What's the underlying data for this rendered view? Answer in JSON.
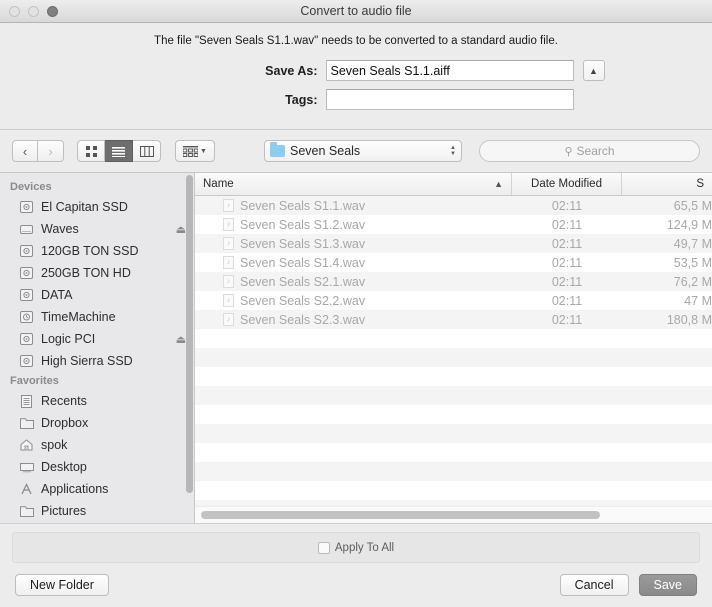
{
  "window": {
    "title": "Convert to audio file",
    "traffic_lights": [
      "close",
      "minimize",
      "zoom"
    ]
  },
  "accessory": {
    "prompt": "The file \"Seven Seals S1.1.wav\" needs to be converted to a standard audio file.",
    "save_as_label": "Save As:",
    "save_as_value": "Seven Seals S1.1.aiff",
    "save_as_placeholder": "",
    "disclosure_icon": "chevron-up-icon",
    "tags_label": "Tags:",
    "tags_value": "",
    "tags_placeholder": ""
  },
  "toolbar": {
    "back_icon": "chevron-left-icon",
    "forward_icon": "chevron-right-icon",
    "view_icon_grid": "icon-view-icon",
    "view_icon_list": "list-view-icon",
    "view_icon_column": "column-view-icon",
    "arrange_icon": "arrange-by-icon",
    "arrange_caret": "chevron-down-icon",
    "path_folder_icon": "folder-icon",
    "path_label": "Seven Seals",
    "path_stepper_icon": "up-down-arrows-icon",
    "search_icon": "search-icon",
    "search_placeholder": "Search",
    "search_value": ""
  },
  "sidebar": {
    "sections": [
      {
        "header": "Devices",
        "items": [
          {
            "label": "El Capitan SSD",
            "icon": "hard-disk-icon",
            "eject": false
          },
          {
            "label": "Waves",
            "icon": "external-disk-icon",
            "eject": true
          },
          {
            "label": "120GB TON SSD",
            "icon": "hard-disk-icon",
            "eject": false
          },
          {
            "label": "250GB TON HD",
            "icon": "hard-disk-icon",
            "eject": false
          },
          {
            "label": "DATA",
            "icon": "hard-disk-icon",
            "eject": false
          },
          {
            "label": "TimeMachine",
            "icon": "time-machine-disk-icon",
            "eject": false
          },
          {
            "label": "Logic PCI",
            "icon": "hard-disk-icon",
            "eject": true
          },
          {
            "label": "High Sierra SSD",
            "icon": "hard-disk-icon",
            "eject": false
          }
        ]
      },
      {
        "header": "Favorites",
        "items": [
          {
            "label": "Recents",
            "icon": "recents-icon",
            "eject": false
          },
          {
            "label": "Dropbox",
            "icon": "folder-icon",
            "eject": false
          },
          {
            "label": "spok",
            "icon": "home-icon",
            "eject": false
          },
          {
            "label": "Desktop",
            "icon": "desktop-icon",
            "eject": false
          },
          {
            "label": "Applications",
            "icon": "applications-icon",
            "eject": false
          },
          {
            "label": "Pictures",
            "icon": "folder-icon",
            "eject": false
          }
        ]
      }
    ]
  },
  "filelist": {
    "columns": [
      {
        "key": "name",
        "label": "Name",
        "sorted": true,
        "sort_icon": "chevron-up-icon"
      },
      {
        "key": "date",
        "label": "Date Modified",
        "sorted": false
      },
      {
        "key": "size",
        "label": "S",
        "sorted": false
      }
    ],
    "rows": [
      {
        "name": "Seven Seals S1.1.wav",
        "date": "02:11",
        "size": "65,5 M",
        "icon": "audio-file-icon",
        "disabled": true
      },
      {
        "name": "Seven Seals S1.2.wav",
        "date": "02:11",
        "size": "124,9 M",
        "icon": "audio-file-icon",
        "disabled": true
      },
      {
        "name": "Seven Seals S1.3.wav",
        "date": "02:11",
        "size": "49,7 M",
        "icon": "audio-file-icon",
        "disabled": true
      },
      {
        "name": "Seven Seals S1.4.wav",
        "date": "02:11",
        "size": "53,5 M",
        "icon": "audio-file-icon",
        "disabled": true
      },
      {
        "name": "Seven Seals S2.1.wav",
        "date": "02:11",
        "size": "76,2 M",
        "icon": "audio-file-icon",
        "disabled": true
      },
      {
        "name": "Seven Seals S2.2.wav",
        "date": "02:11",
        "size": "47 M",
        "icon": "audio-file-icon",
        "disabled": true
      },
      {
        "name": "Seven Seals S2.3.wav",
        "date": "02:11",
        "size": "180,8 M",
        "icon": "audio-file-icon",
        "disabled": true
      }
    ],
    "empty_row_count": 10
  },
  "bottom": {
    "apply_to_all_label": "Apply To All",
    "apply_to_all_checked": false,
    "new_folder_label": "New Folder",
    "cancel_label": "Cancel",
    "save_label": "Save"
  }
}
